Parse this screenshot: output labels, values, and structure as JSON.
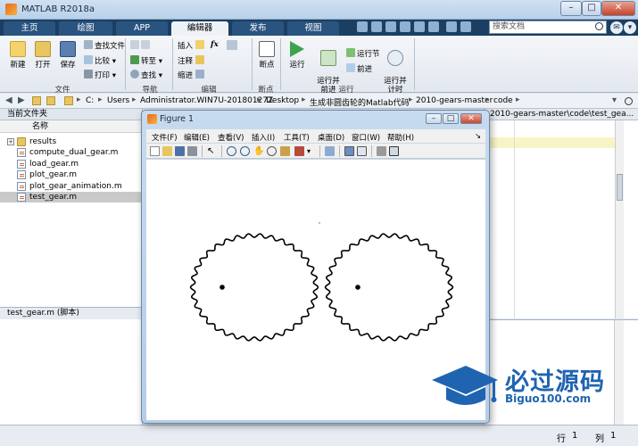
{
  "window": {
    "title": "MATLAB R2018a"
  },
  "tabs": [
    {
      "label": "主页"
    },
    {
      "label": "绘图"
    },
    {
      "label": "APP"
    },
    {
      "label": "编辑器"
    },
    {
      "label": "发布"
    },
    {
      "label": "视图"
    }
  ],
  "search": {
    "placeholder": "搜索文档"
  },
  "ribbon": {
    "file": {
      "new": "新建",
      "open": "打开",
      "save": "保存",
      "find_files": "查找文件",
      "compare": "比较",
      "print": "打印",
      "group": "文件"
    },
    "navigate": {
      "goto": "转至",
      "find": "查找",
      "group": "导航"
    },
    "edit": {
      "insert": "插入",
      "comment": "注释",
      "indent": "缩进",
      "fx": "fx",
      "group": "编辑"
    },
    "breakpoints": {
      "label": "断点",
      "group": "断点"
    },
    "run": {
      "run": "运行",
      "run_advance": "运行并\n前进",
      "run_section": "运行节",
      "advance": "前进",
      "run_time": "运行并\n计时",
      "group": "运行"
    }
  },
  "address": {
    "crumbs": [
      "C:",
      "Users",
      "Administrator.WIN7U-20180127Z",
      "Desktop",
      "生成非圆齿轮的Matlab代码",
      "2010-gears-master",
      "code"
    ]
  },
  "current_folder": {
    "header": "当前文件夹",
    "column": "名称",
    "items": [
      {
        "name": "results",
        "type": "folder"
      },
      {
        "name": "compute_dual_gear.m",
        "type": "m"
      },
      {
        "name": "load_gear.m",
        "type": "m"
      },
      {
        "name": "plot_gear.m",
        "type": "m"
      },
      {
        "name": "plot_gear_animation.m",
        "type": "m"
      },
      {
        "name": "test_gear.m",
        "type": "m",
        "selected": true
      }
    ]
  },
  "details": {
    "header": "test_gear.m  (脚本)"
  },
  "editor": {
    "tab": "2010-gears-master\\code\\test_gea..."
  },
  "status": {
    "row_label": "行",
    "row": "1",
    "col_label": "列",
    "col": "1"
  },
  "figure": {
    "title": "Figure 1",
    "menus": [
      "文件(F)",
      "编辑(E)",
      "查看(V)",
      "插入(I)",
      "工具(T)",
      "桌面(D)",
      "窗口(W)",
      "帮助(H)"
    ]
  },
  "watermark": {
    "cn": "必过源码",
    "en": "Biguo100.com"
  },
  "colors": {
    "ribbon_dark": "#1a3f63",
    "accent": "#1f64b0"
  }
}
